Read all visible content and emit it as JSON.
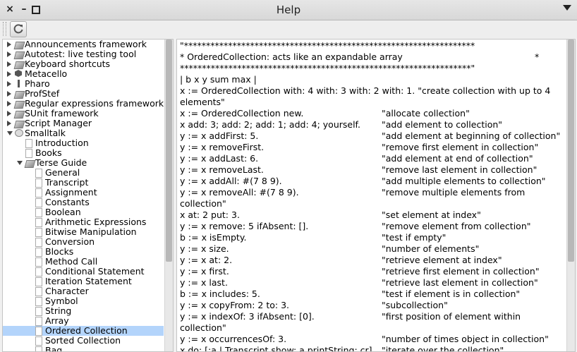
{
  "window": {
    "title": "Help"
  },
  "tree": {
    "items": [
      {
        "label": "Announcements framework",
        "level": 0,
        "expander": "right",
        "icon": "book-icon"
      },
      {
        "label": "Autotest: live testing tool",
        "level": 0,
        "expander": "right",
        "icon": "book-icon"
      },
      {
        "label": "Keyboard shortcuts",
        "level": 0,
        "expander": "right",
        "icon": "book-icon"
      },
      {
        "label": "Metacello",
        "level": 0,
        "expander": "right",
        "icon": "hexagon-icon"
      },
      {
        "label": "Pharo",
        "level": 0,
        "expander": "right",
        "icon": "pharo-icon"
      },
      {
        "label": "ProfStef",
        "level": 0,
        "expander": "right",
        "icon": "book-icon"
      },
      {
        "label": "Regular expressions framework",
        "level": 0,
        "expander": "right",
        "icon": "book-icon"
      },
      {
        "label": "SUnit framework",
        "level": 0,
        "expander": "right",
        "icon": "book-icon"
      },
      {
        "label": "Script Manager",
        "level": 0,
        "expander": "right",
        "icon": "book-icon"
      },
      {
        "label": "Smalltalk",
        "level": 0,
        "expander": "down",
        "icon": "bubble-icon"
      },
      {
        "label": "Introduction",
        "level": 1,
        "expander": "",
        "icon": "page-icon"
      },
      {
        "label": "Books",
        "level": 1,
        "expander": "",
        "icon": "page-icon"
      },
      {
        "label": "Terse Guide",
        "level": 1,
        "expander": "down",
        "icon": "book-icon"
      },
      {
        "label": "General",
        "level": 2,
        "expander": "",
        "icon": "page-icon"
      },
      {
        "label": "Transcript",
        "level": 2,
        "expander": "",
        "icon": "page-icon"
      },
      {
        "label": "Assignment",
        "level": 2,
        "expander": "",
        "icon": "page-icon"
      },
      {
        "label": "Constants",
        "level": 2,
        "expander": "",
        "icon": "page-icon"
      },
      {
        "label": "Boolean",
        "level": 2,
        "expander": "",
        "icon": "page-icon"
      },
      {
        "label": "Arithmetic Expressions",
        "level": 2,
        "expander": "",
        "icon": "page-icon"
      },
      {
        "label": "Bitwise Manipulation",
        "level": 2,
        "expander": "",
        "icon": "page-icon"
      },
      {
        "label": "Conversion",
        "level": 2,
        "expander": "",
        "icon": "page-icon"
      },
      {
        "label": "Blocks",
        "level": 2,
        "expander": "",
        "icon": "page-icon"
      },
      {
        "label": "Method Call",
        "level": 2,
        "expander": "",
        "icon": "page-icon"
      },
      {
        "label": "Conditional Statement",
        "level": 2,
        "expander": "",
        "icon": "page-icon"
      },
      {
        "label": "Iteration Statement",
        "level": 2,
        "expander": "",
        "icon": "page-icon"
      },
      {
        "label": "Character",
        "level": 2,
        "expander": "",
        "icon": "page-icon"
      },
      {
        "label": "Symbol",
        "level": 2,
        "expander": "",
        "icon": "page-icon"
      },
      {
        "label": "String",
        "level": 2,
        "expander": "",
        "icon": "page-icon"
      },
      {
        "label": "Array",
        "level": 2,
        "expander": "",
        "icon": "page-icon"
      },
      {
        "label": "Ordered Collection",
        "level": 2,
        "expander": "",
        "icon": "page-icon",
        "selected": true
      },
      {
        "label": "Sorted Collection",
        "level": 2,
        "expander": "",
        "icon": "page-icon"
      },
      {
        "label": "Bag",
        "level": 2,
        "expander": "",
        "icon": "page-icon"
      }
    ]
  },
  "content": {
    "header": [
      "\"******************************************************************",
      "* OrderedCollection: acts like an expandable array",
      "******************************************************************\""
    ],
    "header_star": "*",
    "lines": [
      {
        "code": "| b x y sum max |",
        "comment": ""
      },
      {
        "code": "x := OrderedCollection with: 4 with: 3 with: 2 with: 1.      \"create collection with up to 4",
        "comment": ""
      },
      {
        "code": "elements\"",
        "comment": ""
      },
      {
        "code": "x := OrderedCollection new.",
        "comment": "\"allocate collection\""
      },
      {
        "code": "x add: 3; add: 2; add: 1; add: 4; yourself.",
        "comment": "\"add element to collection\""
      },
      {
        "code": "y := x addFirst: 5.",
        "comment": "\"add element at beginning of collection\""
      },
      {
        "code": "y := x removeFirst.",
        "comment": "\"remove first element in collection\""
      },
      {
        "code": "y := x addLast: 6.",
        "comment": "\"add element at end of collection\""
      },
      {
        "code": "y := x removeLast.",
        "comment": "\"remove last element in collection\""
      },
      {
        "code": "y := x addAll: #(7 8 9).",
        "comment": "\"add multiple elements to collection\""
      },
      {
        "code": "y := x removeAll: #(7 8 9).",
        "comment": "\"remove multiple elements from"
      },
      {
        "code": "collection\"",
        "comment": ""
      },
      {
        "code": "x at: 2 put: 3.",
        "comment": "\"set element at index\""
      },
      {
        "code": "y := x remove: 5 ifAbsent: [].",
        "comment": "\"remove element from collection\""
      },
      {
        "code": "b := x isEmpty.",
        "comment": "\"test if empty\""
      },
      {
        "code": "y := x size.",
        "comment": "\"number of elements\""
      },
      {
        "code": "y := x at: 2.",
        "comment": "\"retrieve element at index\""
      },
      {
        "code": "y := x first.",
        "comment": "\"retrieve first element in collection\""
      },
      {
        "code": "y := x last.",
        "comment": "\"retrieve last element in collection\""
      },
      {
        "code": "b := x includes: 5.",
        "comment": "\"test if element is in collection\""
      },
      {
        "code": "y := x copyFrom: 2 to: 3.",
        "comment": "\"subcollection\""
      },
      {
        "code": "y := x indexOf: 3 ifAbsent: [0].",
        "comment": "\"first position of element within"
      },
      {
        "code": "collection\"",
        "comment": ""
      },
      {
        "code": "y := x occurrencesOf: 3.",
        "comment": "\"number of times object in collection\""
      },
      {
        "code": "x do: [:a | Transcript show: a printString; cr].",
        "comment": "\"iterate over the collection\""
      }
    ]
  }
}
